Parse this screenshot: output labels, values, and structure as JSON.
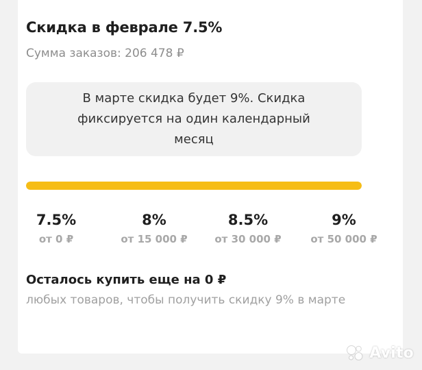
{
  "summary": {
    "title": "Скидка в феврале 7.5%",
    "subtitle": "Сумма заказов: 206 478 ₽"
  },
  "info": {
    "text": "В марте скидка будет 9%. Скидка фиксируется на один календарный месяц"
  },
  "progress": {
    "fraction": 1.0,
    "color": "#f6bd16"
  },
  "tiers": [
    {
      "percent": "7.5%",
      "threshold": "от 0 ₽"
    },
    {
      "percent": "8%",
      "threshold": "от 15 000 ₽"
    },
    {
      "percent": "8.5%",
      "threshold": "от 30 000 ₽"
    },
    {
      "percent": "9%",
      "threshold": "от 50 000 ₽"
    }
  ],
  "remaining": {
    "title": "Осталось купить еще на 0 ₽",
    "description": "любых товаров, чтобы получить скидку 9% в марте"
  },
  "watermark": {
    "text": "Avito",
    "icon": "avito-logo-icon"
  }
}
